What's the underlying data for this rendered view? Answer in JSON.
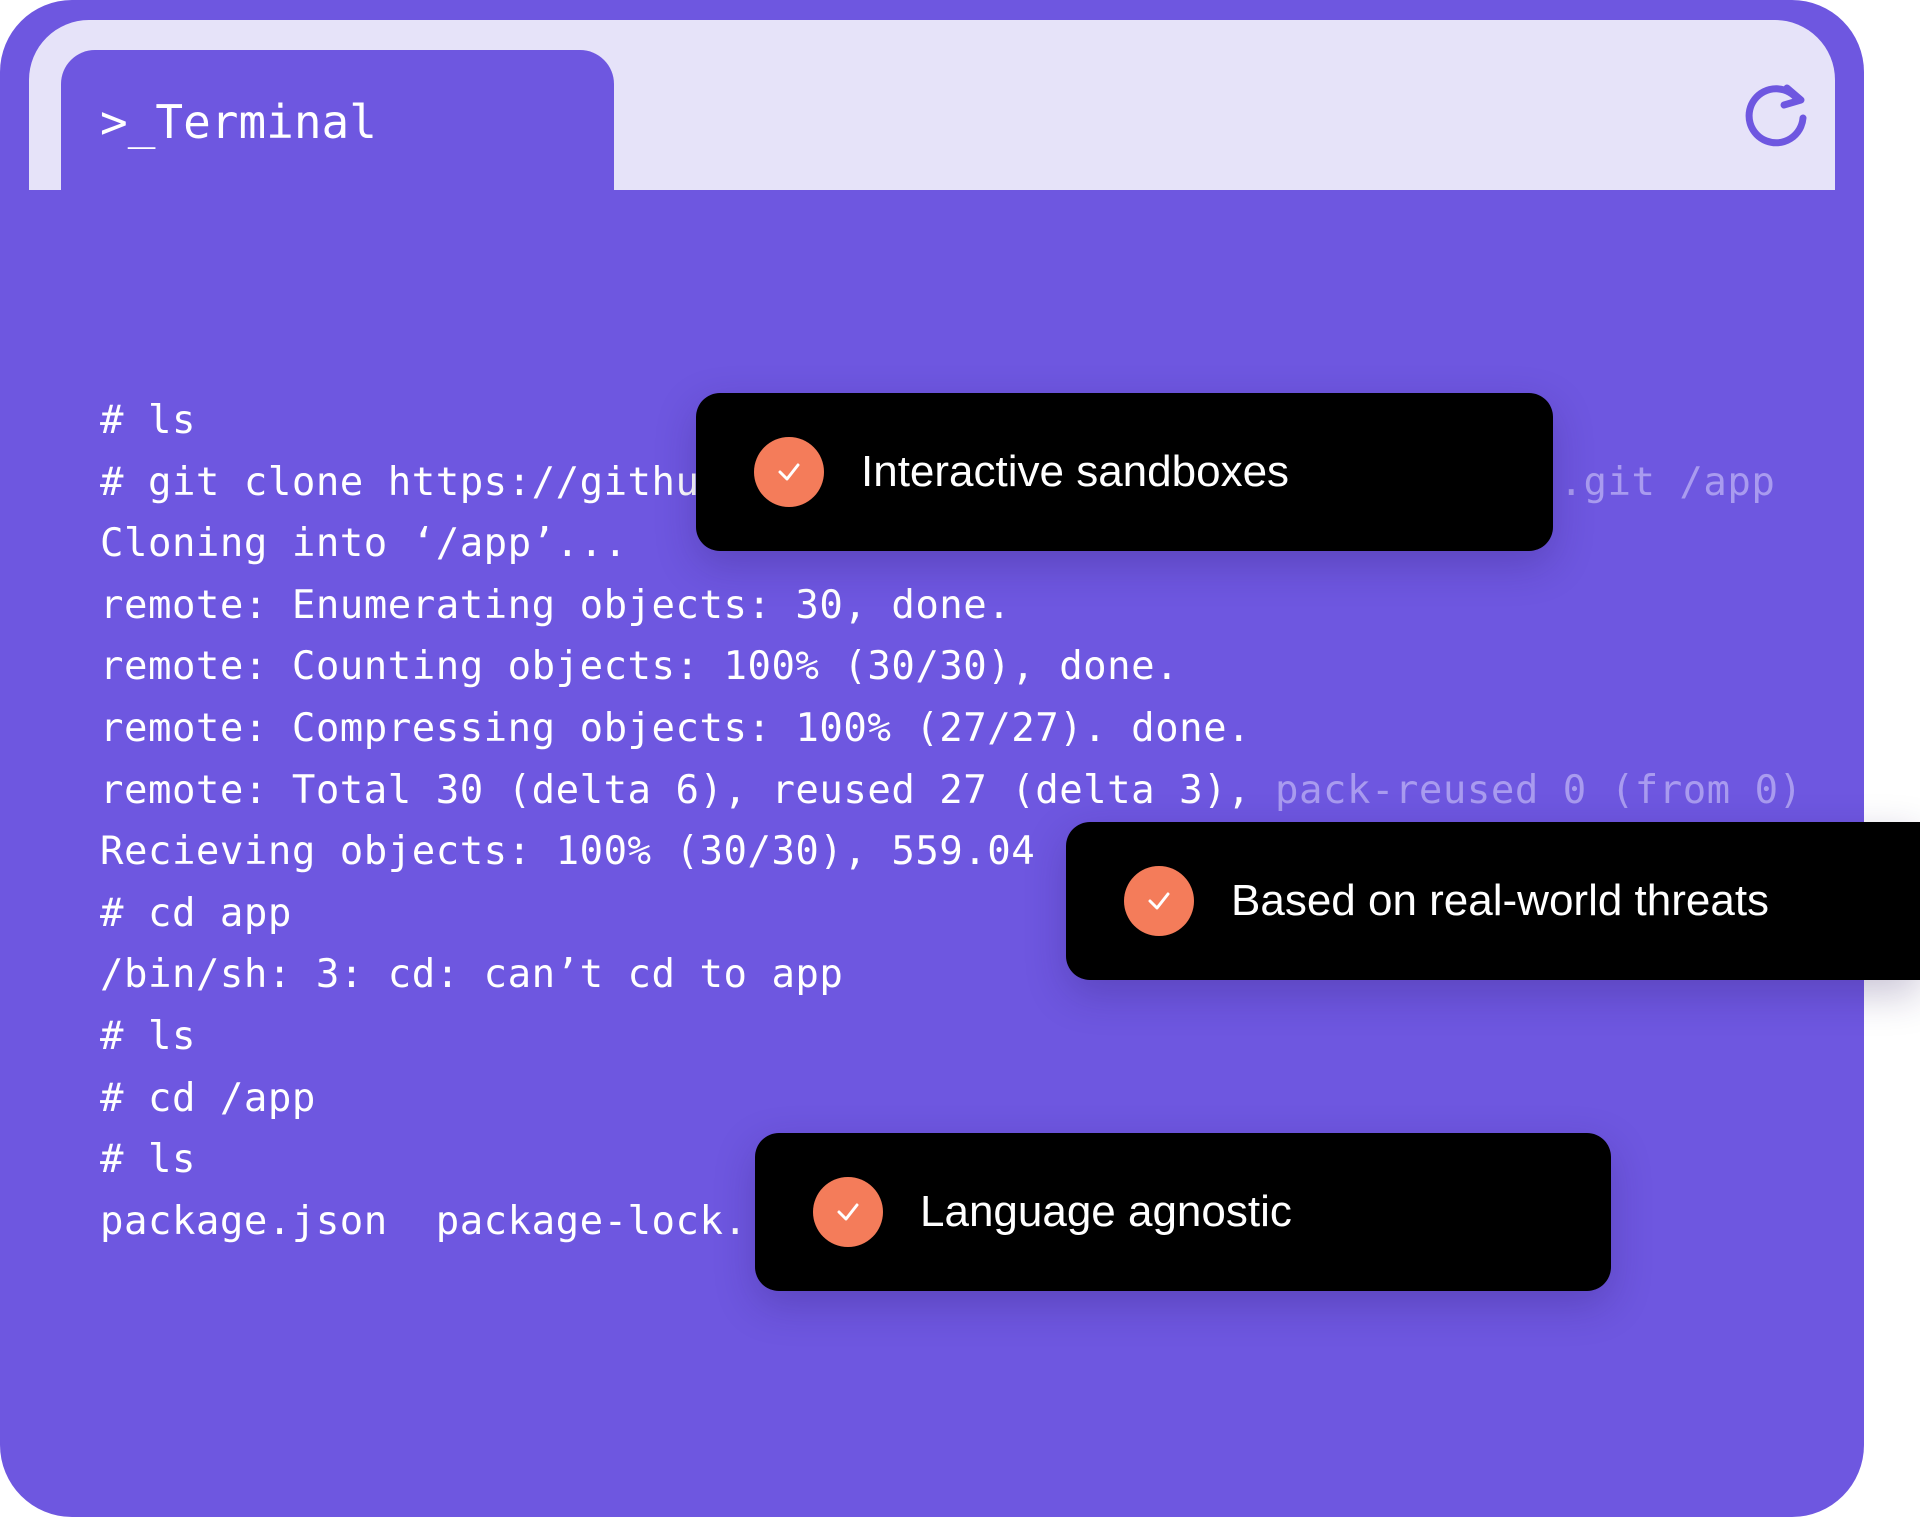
{
  "window": {
    "tab_label": ">_Terminal",
    "refresh_icon": "refresh-icon",
    "colors": {
      "background": "#6e57e0",
      "titlebar": "#e6e3f9",
      "text": "#ffffff",
      "dim_text": "#a99bef",
      "badge": "#000000",
      "check": "#f47c5a"
    }
  },
  "terminal": {
    "lines": [
      {
        "text": "# ls"
      },
      {
        "text": "# git clone https://githu",
        "dim": ".git /app"
      },
      {
        "text": "Cloning into ‘/app’..."
      },
      {
        "text": "remote: Enumerating objects: 30, done."
      },
      {
        "text": "remote: Counting objects: 100% (30/30), done."
      },
      {
        "text": "remote: Compressing objects: 100% (27/27). done."
      },
      {
        "text": "remote: Total 30 (delta 6), reused 27 (delta 3), ",
        "dim": "pack-reused 0 (from 0)"
      },
      {
        "text": "Recieving objects: 100% (30/30), 559.04"
      },
      {
        "text": "# cd app"
      },
      {
        "text": "/bin/sh: 3: cd: can’t cd to app"
      },
      {
        "text": "# ls"
      },
      {
        "text": "# cd /app"
      },
      {
        "text": "# ls"
      },
      {
        "text": "package.json  package-lock."
      }
    ]
  },
  "badges": [
    {
      "label": "Interactive sandboxes",
      "icon": "check-icon"
    },
    {
      "label": "Based on real-world threats",
      "icon": "check-icon"
    },
    {
      "label": "Language agnostic",
      "icon": "check-icon"
    }
  ]
}
